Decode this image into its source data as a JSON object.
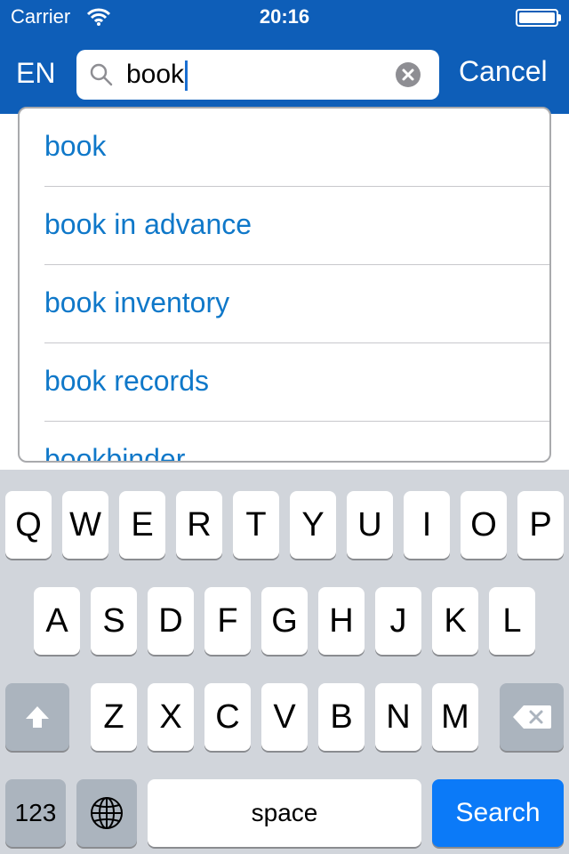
{
  "status_bar": {
    "carrier": "Carrier",
    "time": "20:16"
  },
  "header": {
    "language": "EN",
    "search": {
      "value": "book",
      "placeholder": ""
    },
    "cancel_label": "Cancel"
  },
  "suggestions": [
    {
      "label": "book"
    },
    {
      "label": "book in advance"
    },
    {
      "label": "book inventory"
    },
    {
      "label": "book records"
    },
    {
      "label": "bookbinder"
    }
  ],
  "keyboard": {
    "row1": [
      "Q",
      "W",
      "E",
      "R",
      "T",
      "Y",
      "U",
      "I",
      "O",
      "P"
    ],
    "row2": [
      "A",
      "S",
      "D",
      "F",
      "G",
      "H",
      "J",
      "K",
      "L"
    ],
    "row3": [
      "Z",
      "X",
      "C",
      "V",
      "B",
      "N",
      "M"
    ],
    "numbers_label": "123",
    "space_label": "space",
    "search_label": "Search"
  },
  "icons": {
    "search": "search-icon",
    "clear": "clear-icon",
    "wifi": "wifi-icon",
    "battery": "battery-icon",
    "shift": "shift-icon",
    "backspace": "backspace-icon",
    "globe": "globe-icon"
  },
  "colors": {
    "header_bg": "#0e5eb8",
    "suggestion_text": "#0f78c9",
    "search_key": "#0b7af8",
    "keyboard_bg": "#d1d5db"
  }
}
